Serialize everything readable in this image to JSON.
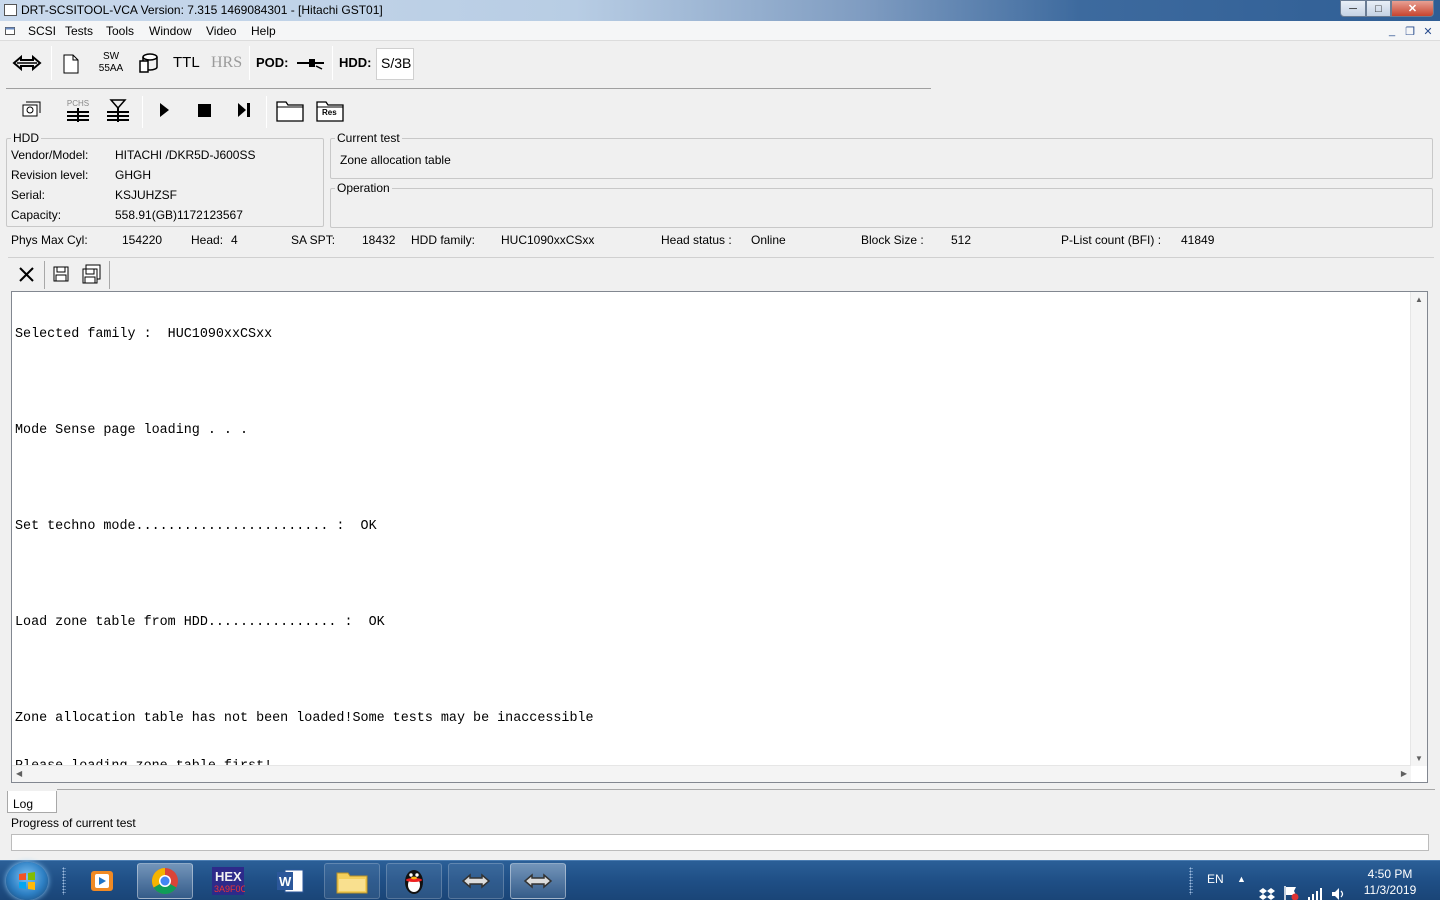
{
  "window": {
    "title": "DRT-SCSITOOL-VCA Version: 7.315  1469084301 - [Hitachi GST01]",
    "buttons": {
      "minimize": "─",
      "maximize": "□",
      "close": "✕"
    }
  },
  "menubar": {
    "items": [
      "SCSI",
      "Tests",
      "Tools",
      "Window",
      "Video",
      "Help"
    ],
    "mdi_buttons": {
      "minimize": "_",
      "restore": "❐",
      "close": "✕"
    }
  },
  "toolbar1": {
    "sw_label_top": "SW",
    "sw_label_bottom": "55AA",
    "ttl": "TTL",
    "hrs": "HRS",
    "pod_label": "POD:",
    "hdd_label": "HDD:",
    "hdd_value": "S/3B"
  },
  "toolbar2": {
    "pchs_label": "PCHS",
    "res_label": "Res"
  },
  "hdd_info": {
    "legend": "HDD",
    "rows": [
      {
        "label": "Vendor/Model:",
        "value": "HITACHI /DKR5D-J600SS"
      },
      {
        "label": "Revision level:",
        "value": "GHGH"
      },
      {
        "label": "Serial:",
        "value": "KSJUHZSF"
      },
      {
        "label": "Capacity:",
        "value": "558.91(GB)1172123567"
      }
    ]
  },
  "current_test": {
    "legend": "Current test",
    "value": "Zone allocation table"
  },
  "operation": {
    "legend": "Operation",
    "value": ""
  },
  "status_line": {
    "phys_max_cyl_label": "Phys Max Cyl:",
    "phys_max_cyl_value": "154220",
    "head_label": "Head:",
    "head_value": "4",
    "sa_spt_label": "SA SPT:",
    "sa_spt_value": "18432",
    "hdd_family_label": "HDD family:",
    "hdd_family_value": "HUC1090xxCSxx",
    "head_status_label": "Head status :",
    "head_status_value": "Online",
    "block_size_label": "Block Size :",
    "block_size_value": "512",
    "plist_label": "P-List count (BFI) :",
    "plist_value": "41849"
  },
  "log": {
    "lines": [
      "Selected family :  HUC1090xxCSxx",
      "",
      "Mode Sense page loading . . .",
      "",
      "Set techno mode........................ :  OK",
      "",
      "Load zone table from HDD................ :  OK",
      "",
      "Zone allocation table has not been loaded!Some tests may be inaccessible",
      "Please loading zone table first!"
    ],
    "tab_label": "Log"
  },
  "progress": {
    "label": "Progress of  current test",
    "value": 0
  },
  "taskbar": {
    "apps": [
      "media-player",
      "chrome",
      "hex-editor",
      "word",
      "file-explorer",
      "qq",
      "scsitool-1",
      "scsitool-2"
    ],
    "tray": {
      "lang": "EN",
      "time": "4:50 PM",
      "date": "11/3/2019"
    }
  },
  "colors": {
    "window_bg": "#f0f0f0",
    "taskbar": "#1f4f86",
    "progress_fill": "#3ab03a"
  }
}
